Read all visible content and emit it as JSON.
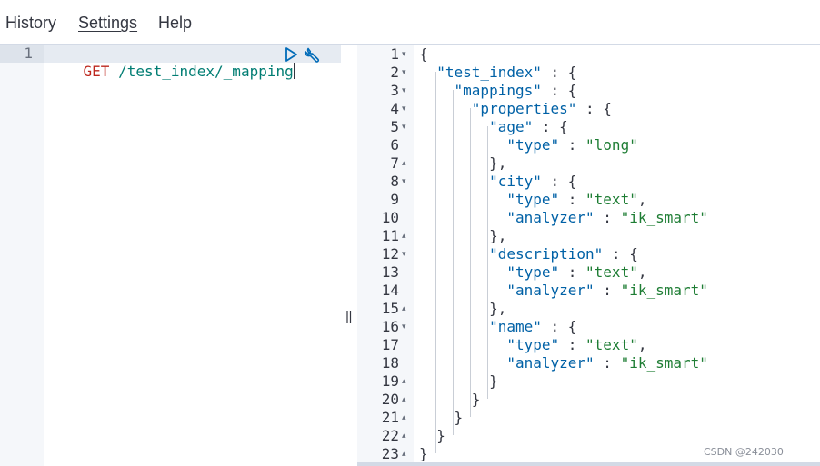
{
  "nav": {
    "history_label": "History",
    "settings_label": "Settings",
    "help_label": "Help"
  },
  "request_editor": {
    "line_number": "1",
    "method": "GET",
    "path": "/test_index/_mapping"
  },
  "icons": {
    "run": "play-triangle-icon",
    "wrench": "wrench-icon",
    "divider": "resize-handle-icon"
  },
  "response": {
    "lines": [
      {
        "n": "1",
        "fold": "▾",
        "tokens": [
          [
            "pun",
            "{"
          ]
        ]
      },
      {
        "n": "2",
        "fold": "▾",
        "tokens": [
          [
            "pun",
            "  "
          ],
          [
            "key",
            "\"test_index\""
          ],
          [
            "pun",
            " : {"
          ]
        ]
      },
      {
        "n": "3",
        "fold": "▾",
        "tokens": [
          [
            "pun",
            "    "
          ],
          [
            "key",
            "\"mappings\""
          ],
          [
            "pun",
            " : {"
          ]
        ]
      },
      {
        "n": "4",
        "fold": "▾",
        "tokens": [
          [
            "pun",
            "      "
          ],
          [
            "key",
            "\"properties\""
          ],
          [
            "pun",
            " : {"
          ]
        ]
      },
      {
        "n": "5",
        "fold": "▾",
        "tokens": [
          [
            "pun",
            "        "
          ],
          [
            "key",
            "\"age\""
          ],
          [
            "pun",
            " : {"
          ]
        ]
      },
      {
        "n": "6",
        "fold": "",
        "tokens": [
          [
            "pun",
            "          "
          ],
          [
            "key",
            "\"type\""
          ],
          [
            "pun",
            " : "
          ],
          [
            "str",
            "\"long\""
          ]
        ]
      },
      {
        "n": "7",
        "fold": "▴",
        "tokens": [
          [
            "pun",
            "        },"
          ]
        ]
      },
      {
        "n": "8",
        "fold": "▾",
        "tokens": [
          [
            "pun",
            "        "
          ],
          [
            "key",
            "\"city\""
          ],
          [
            "pun",
            " : {"
          ]
        ]
      },
      {
        "n": "9",
        "fold": "",
        "tokens": [
          [
            "pun",
            "          "
          ],
          [
            "key",
            "\"type\""
          ],
          [
            "pun",
            " : "
          ],
          [
            "str",
            "\"text\""
          ],
          [
            "pun",
            ","
          ]
        ]
      },
      {
        "n": "10",
        "fold": "",
        "tokens": [
          [
            "pun",
            "          "
          ],
          [
            "key",
            "\"analyzer\""
          ],
          [
            "pun",
            " : "
          ],
          [
            "str",
            "\"ik_smart\""
          ]
        ]
      },
      {
        "n": "11",
        "fold": "▴",
        "tokens": [
          [
            "pun",
            "        },"
          ]
        ]
      },
      {
        "n": "12",
        "fold": "▾",
        "tokens": [
          [
            "pun",
            "        "
          ],
          [
            "key",
            "\"description\""
          ],
          [
            "pun",
            " : {"
          ]
        ]
      },
      {
        "n": "13",
        "fold": "",
        "tokens": [
          [
            "pun",
            "          "
          ],
          [
            "key",
            "\"type\""
          ],
          [
            "pun",
            " : "
          ],
          [
            "str",
            "\"text\""
          ],
          [
            "pun",
            ","
          ]
        ]
      },
      {
        "n": "14",
        "fold": "",
        "tokens": [
          [
            "pun",
            "          "
          ],
          [
            "key",
            "\"analyzer\""
          ],
          [
            "pun",
            " : "
          ],
          [
            "str",
            "\"ik_smart\""
          ]
        ]
      },
      {
        "n": "15",
        "fold": "▴",
        "tokens": [
          [
            "pun",
            "        },"
          ]
        ]
      },
      {
        "n": "16",
        "fold": "▾",
        "tokens": [
          [
            "pun",
            "        "
          ],
          [
            "key",
            "\"name\""
          ],
          [
            "pun",
            " : {"
          ]
        ]
      },
      {
        "n": "17",
        "fold": "",
        "tokens": [
          [
            "pun",
            "          "
          ],
          [
            "key",
            "\"type\""
          ],
          [
            "pun",
            " : "
          ],
          [
            "str",
            "\"text\""
          ],
          [
            "pun",
            ","
          ]
        ]
      },
      {
        "n": "18",
        "fold": "",
        "tokens": [
          [
            "pun",
            "          "
          ],
          [
            "key",
            "\"analyzer\""
          ],
          [
            "pun",
            " : "
          ],
          [
            "str",
            "\"ik_smart\""
          ]
        ]
      },
      {
        "n": "19",
        "fold": "▴",
        "tokens": [
          [
            "pun",
            "        }"
          ]
        ]
      },
      {
        "n": "20",
        "fold": "▴",
        "tokens": [
          [
            "pun",
            "      }"
          ]
        ]
      },
      {
        "n": "21",
        "fold": "▴",
        "tokens": [
          [
            "pun",
            "    }"
          ]
        ]
      },
      {
        "n": "22",
        "fold": "▴",
        "tokens": [
          [
            "pun",
            "  }"
          ]
        ]
      },
      {
        "n": "23",
        "fold": "▴",
        "tokens": [
          [
            "pun",
            "}"
          ]
        ]
      }
    ]
  },
  "watermark": "CSDN @242030",
  "colors": {
    "method": "#bd271e",
    "path": "#017d73",
    "json_key": "#0061a6",
    "json_string": "#1e7d34",
    "active_line": "#e6ebf2"
  }
}
